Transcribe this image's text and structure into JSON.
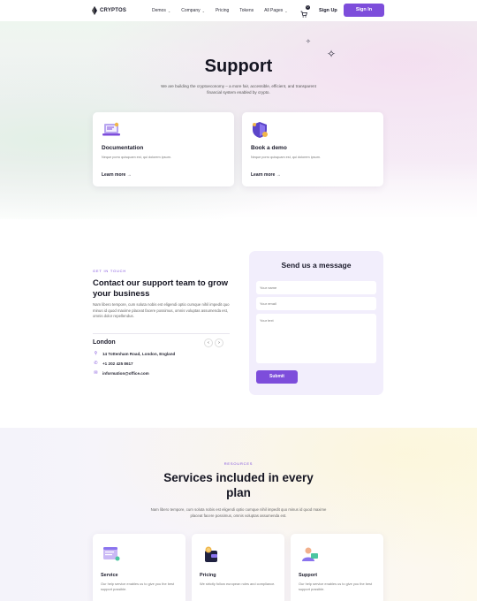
{
  "nav": {
    "brand": "CRYPTOS",
    "menu": [
      {
        "label": "Demos",
        "has_dropdown": true
      },
      {
        "label": "Company",
        "has_dropdown": true
      },
      {
        "label": "Pricing",
        "has_dropdown": false
      },
      {
        "label": "Tokens",
        "has_dropdown": false
      },
      {
        "label": "All Pages",
        "has_dropdown": true
      }
    ],
    "cart_count": "0",
    "signup_label": "Sign Up",
    "signin_label": "Sign In"
  },
  "hero": {
    "title": "Support",
    "subtitle": "We are building the cryptoeconomy – a more fair, accessible, efficient, and transparent financial system enabled by crypto.",
    "cards": [
      {
        "title": "Documentation",
        "description": "Neque porro quisquam est, qui dolorem ipsum.",
        "link": "Learn more"
      },
      {
        "title": "Book a demo",
        "description": "Neque porro quisquam est, qui dolorem ipsum.",
        "link": "Learn more"
      }
    ]
  },
  "contact": {
    "eyebrow": "GET IN TOUCH",
    "title": "Contact our support team to grow your business",
    "description": "Nam libero tempore, cum soluta nobis est eligendi optio cumque nihil impedit quo minus id quod maxime placeat facere possimus, omnis voluptas assumenda est, omnis dolor repellendus.",
    "city": "London",
    "address": "14 Tottenham Road, London, England",
    "phone": "+1 202 425 8617",
    "email": "information@office.com"
  },
  "form": {
    "title": "Send us a message",
    "name_placeholder": "Your name",
    "email_placeholder": "Your email",
    "text_placeholder": "Your text",
    "submit_label": "Submit"
  },
  "services": {
    "eyebrow": "RESOURCES",
    "title": "Services included in every plan",
    "description": "Nam libero tempore, cum soluta nobis est eligendi optio cumque nihil impedit quo minus id quod maxime placeat facere possimus, omnis voluptas assumenda est.",
    "cards": [
      {
        "title": "Service",
        "description": "Our help service enables us to give you the best support possible."
      },
      {
        "title": "Pricing",
        "description": "We strictly follow european rules and compliance."
      },
      {
        "title": "Support",
        "description": "Our help service enables us to give you the best support possible."
      }
    ]
  },
  "colors": {
    "accent": "#7d4ddb",
    "text": "#151522"
  }
}
